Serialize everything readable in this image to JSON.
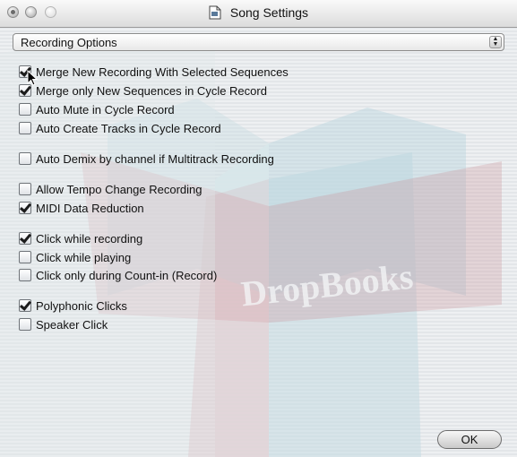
{
  "window": {
    "title": "Song Settings",
    "title_icon": "document-icon"
  },
  "popup": {
    "selected": "Recording Options",
    "arrows_icon": "up-down-arrows-icon"
  },
  "options": [
    {
      "label": "Merge New Recording With Selected Sequences",
      "checked": true
    },
    {
      "label": "Merge only New Sequences in Cycle Record",
      "checked": true
    },
    {
      "label": "Auto Mute in Cycle Record",
      "checked": false
    },
    {
      "label": "Auto Create Tracks in Cycle Record",
      "checked": false
    },
    {
      "label": "Auto Demix by channel if Multitrack Recording",
      "checked": false
    },
    {
      "label": "Allow Tempo Change Recording",
      "checked": false
    },
    {
      "label": "MIDI Data Reduction",
      "checked": true
    },
    {
      "label": "Click while recording",
      "checked": true
    },
    {
      "label": "Click while playing",
      "checked": false
    },
    {
      "label": "Click only during Count-in (Record)",
      "checked": false
    },
    {
      "label": "Polyphonic Clicks",
      "checked": true
    },
    {
      "label": "Speaker Click",
      "checked": false
    }
  ],
  "ok_label": "OK",
  "watermark_text": "DropBooks",
  "colors": {
    "watermark_red": "#c77e85",
    "watermark_blue": "#9fc3cf"
  }
}
